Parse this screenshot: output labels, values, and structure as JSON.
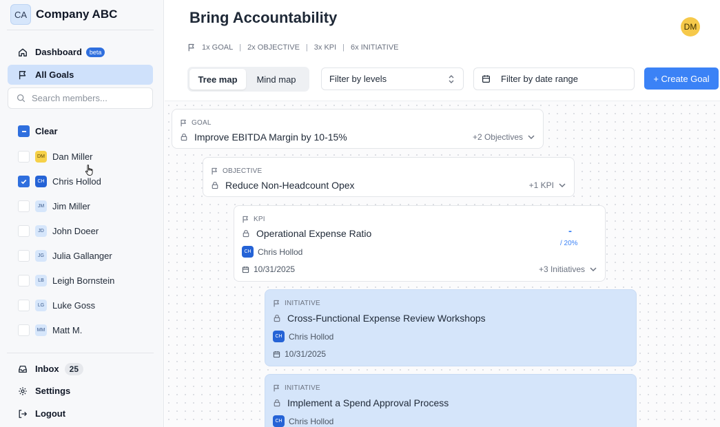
{
  "brand": {
    "logo_text": "CA",
    "name": "Company ABC"
  },
  "nav": {
    "dashboard": {
      "label": "Dashboard",
      "badge": "beta"
    },
    "all_goals": {
      "label": "All Goals"
    }
  },
  "search": {
    "placeholder": "Search members..."
  },
  "filter": {
    "clear_label": "Clear",
    "members": [
      {
        "initials": "DM",
        "name": "Dan Miller",
        "checked": false
      },
      {
        "initials": "CH",
        "name": "Chris Hollod",
        "checked": true
      },
      {
        "initials": "JM",
        "name": "Jim Miller",
        "checked": false
      },
      {
        "initials": "JD",
        "name": "John Doeer",
        "checked": false
      },
      {
        "initials": "JG",
        "name": "Julia Gallanger",
        "checked": false
      },
      {
        "initials": "LB",
        "name": "Leigh Bornstein",
        "checked": false
      },
      {
        "initials": "LG",
        "name": "Luke Goss",
        "checked": false
      },
      {
        "initials": "MM",
        "name": "Matt M.",
        "checked": false
      }
    ]
  },
  "bottom_nav": {
    "inbox": {
      "label": "Inbox",
      "count": "25"
    },
    "settings": {
      "label": "Settings"
    },
    "logout": {
      "label": "Logout"
    }
  },
  "header": {
    "title": "Bring Accountability",
    "user_initials": "DM",
    "summary": [
      "1x GOAL",
      "2x OBJECTIVE",
      "3x KPI",
      "6x INITIATIVE"
    ]
  },
  "toolbar": {
    "view_tabs": [
      "Tree map",
      "Mind map"
    ],
    "filter_levels": "Filter by levels",
    "filter_date": "Filter by date range",
    "create_goal": "+ Create Goal"
  },
  "cards": {
    "goal": {
      "type": "GOAL",
      "title": "Improve EBITDA Margin by 10-15%",
      "more": "+2 Objectives"
    },
    "objective": {
      "type": "OBJECTIVE",
      "title": "Reduce Non-Headcount Opex",
      "more": "+1 KPI"
    },
    "kpi": {
      "type": "KPI",
      "title": "Operational Expense Ratio",
      "owner_initials": "CH",
      "owner": "Chris Hollod",
      "date": "10/31/2025",
      "progress_current": "-",
      "progress_target": "/ 20%",
      "more": "+3 Initiatives"
    },
    "initiative_1": {
      "type": "INITIATIVE",
      "title": "Cross-Functional Expense Review Workshops",
      "owner_initials": "CH",
      "owner": "Chris Hollod",
      "date": "10/31/2025"
    },
    "initiative_2": {
      "type": "INITIATIVE",
      "title": "Implement a Spend Approval Process",
      "owner_initials": "CH",
      "owner": "Chris Hollod"
    }
  },
  "colors": {
    "accent": "#3b82f6",
    "active_nav": "#cfe1fb",
    "initiative_card": "#d5e5fa"
  }
}
